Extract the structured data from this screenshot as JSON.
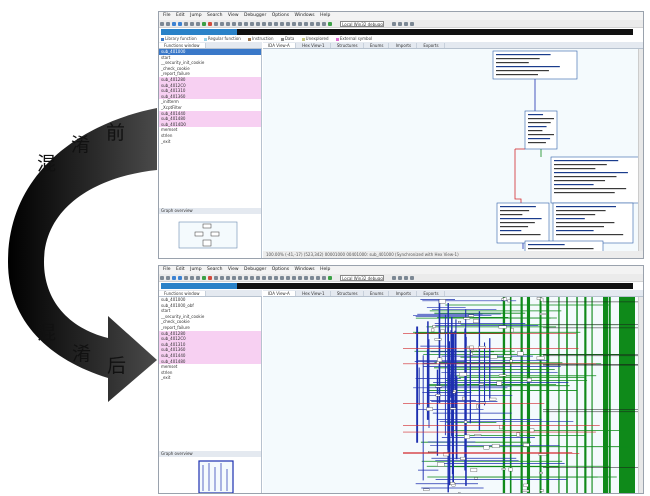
{
  "labels": {
    "before": [
      "混",
      "淆",
      "前"
    ],
    "after": [
      "混",
      "淆",
      "后"
    ]
  },
  "ida_top": {
    "menu": [
      "File",
      "Edit",
      "Jump",
      "Search",
      "View",
      "Debugger",
      "Options",
      "Windows",
      "Help"
    ],
    "debugger_select": "Local Win32 debugger",
    "tabs_left": [
      "Functions window"
    ],
    "tabs_right": [
      "IDA View-A",
      "Hex View-1",
      "Structures",
      "Enums",
      "Imports",
      "Exports"
    ],
    "functions": [
      {
        "name": "sub_401000",
        "style": "selected"
      },
      {
        "name": "start",
        "style": "normal"
      },
      {
        "name": "__security_init_cookie",
        "style": "normal"
      },
      {
        "name": "_check_cookie",
        "style": "normal"
      },
      {
        "name": "_report_failure",
        "style": "normal"
      },
      {
        "name": "sub_401280",
        "style": "highlight"
      },
      {
        "name": "sub_4012C0",
        "style": "highlight"
      },
      {
        "name": "sub_401310",
        "style": "highlight"
      },
      {
        "name": "sub_401360",
        "style": "highlight"
      },
      {
        "name": "_initterm",
        "style": "normal"
      },
      {
        "name": "_XcptFilter",
        "style": "normal"
      },
      {
        "name": "sub_401440",
        "style": "highlight"
      },
      {
        "name": "sub_401480",
        "style": "highlight"
      },
      {
        "name": "sub_4014D0",
        "style": "highlight"
      },
      {
        "name": "memset",
        "style": "normal"
      },
      {
        "name": "strlen",
        "style": "normal"
      },
      {
        "name": "_exit",
        "style": "normal"
      }
    ],
    "graph_overview_title": "Graph overview",
    "status": "100.00% (-41,-17) (523,342) 00001000 00401000: sub_401000 (Synchronized with Hex View-1)"
  },
  "ida_bottom": {
    "menu": [
      "File",
      "Edit",
      "Jump",
      "Search",
      "View",
      "Debugger",
      "Options",
      "Windows",
      "Help"
    ],
    "debugger_select": "Local Win32 debugger",
    "tabs_left": [
      "Functions window"
    ],
    "tabs_right": [
      "IDA View-A",
      "Hex View-1",
      "Structures",
      "Enums",
      "Imports",
      "Exports"
    ],
    "functions": [
      {
        "name": "sub_401000",
        "style": "normal"
      },
      {
        "name": "sub_401000_obf",
        "style": "normal"
      },
      {
        "name": "start",
        "style": "normal"
      },
      {
        "name": "__security_init_cookie",
        "style": "normal"
      },
      {
        "name": "_check_cookie",
        "style": "normal"
      },
      {
        "name": "_report_failure",
        "style": "normal"
      },
      {
        "name": "sub_401280",
        "style": "highlight"
      },
      {
        "name": "sub_4012C0",
        "style": "highlight"
      },
      {
        "name": "sub_401310",
        "style": "highlight"
      },
      {
        "name": "sub_401360",
        "style": "highlight"
      },
      {
        "name": "sub_401440",
        "style": "highlight"
      },
      {
        "name": "sub_401480",
        "style": "highlight"
      },
      {
        "name": "memset",
        "style": "normal"
      },
      {
        "name": "strlen",
        "style": "normal"
      },
      {
        "name": "_exit",
        "style": "normal"
      }
    ],
    "graph_overview_title": "Graph overview"
  },
  "colors": {
    "highlight_row": "#f7d0f2",
    "selected_row": "#3a78c8",
    "graph_bg": "#f4fafd",
    "edge_blue": "#1c2fb0",
    "edge_green": "#0f8a1a",
    "edge_red": "#d2282d",
    "arrow_fill": "#1a1a1a"
  }
}
